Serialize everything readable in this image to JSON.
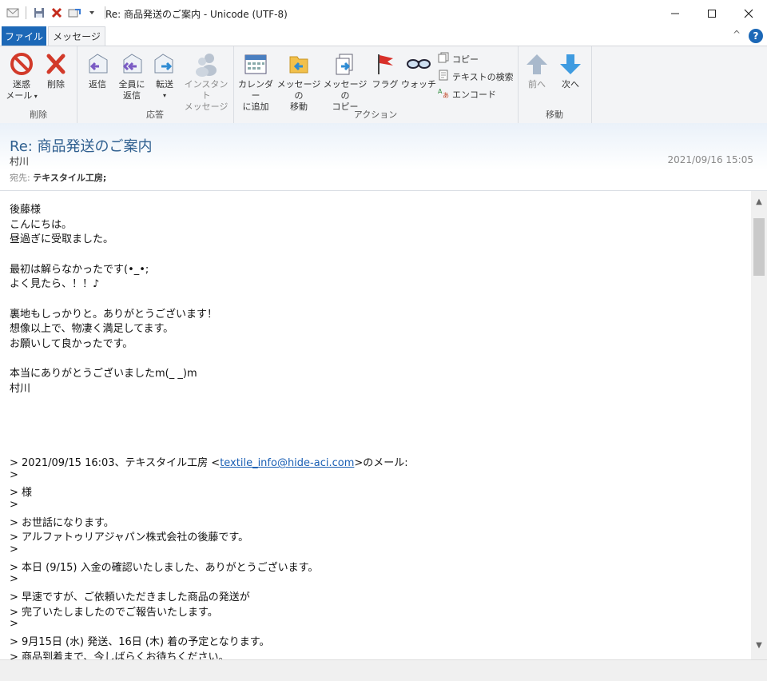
{
  "window": {
    "title": "Re: 商品発送のご案内 - Unicode (UTF-8)",
    "controls": [
      "minimize",
      "maximize",
      "close"
    ]
  },
  "ribbon": {
    "tabs": {
      "file": "ファイル",
      "message": "メッセージ"
    },
    "groups": {
      "delete": {
        "label": "削除",
        "junk": "迷惑\nメール",
        "delete": "削除"
      },
      "respond": {
        "label": "応答",
        "reply": "返信",
        "reply_all": "全員に\n返信",
        "forward": "転送",
        "im": "インスタント\nメッセージ"
      },
      "actions": {
        "label": "アクション",
        "add_calendar": "カレンダー\nに追加",
        "move_message": "メッセージの\n移動",
        "copy_message": "メッセージの\nコピー",
        "flag": "フラグ",
        "watch": "ウォッチ",
        "copy": "コピー",
        "find_text": "テキストの検索",
        "encode": "エンコード"
      },
      "move": {
        "label": "移動",
        "prev": "前へ",
        "next": "次へ"
      }
    }
  },
  "header": {
    "subject": "Re: 商品発送のご案内",
    "from": "村川",
    "date": "2021/09/16 15:05",
    "to_label": "宛先:",
    "to": "テキスタイル工房;"
  },
  "body": {
    "lines": [
      "後藤様",
      "こんにちは。",
      "昼過ぎに受取ました。",
      "",
      "最初は解らなかったです(•_•;",
      "よく見たら、！！♪",
      "",
      "裏地もしっかりと。ありがとうございます！",
      "想像以上で、物凄く満足してます。",
      "お願いして良かったです。",
      "",
      "本当にありがとうございましたm(_ _)m",
      "村川",
      "",
      "",
      "",
      "",
      "> 2021/09/15 16:03、テキスタイル工房 <",
      ">",
      ">           様",
      ">",
      "> お世話になります。",
      "> アルファトゥリアジャパン株式会社の後藤です。",
      ">",
      "> 本日 (9/15) 入金の確認いたしました、ありがとうございます。",
      ">",
      "> 早速ですが、ご依頼いただきました商品の発送が",
      "> 完了いたしましたのでご報告いたします。",
      ">",
      "> 9月15日 (水) 発送、16日 (木) 着の予定となります。",
      "> 商品到着まで、今しばらくお待ちください。",
      ">"
    ],
    "quote_email": "textile_info@hide-aci.com",
    "quote_suffix": ">のメール:"
  },
  "colors": {
    "file_tab": "#1c68b7",
    "subject": "#2f5f8f",
    "link": "#1a5fb4"
  }
}
